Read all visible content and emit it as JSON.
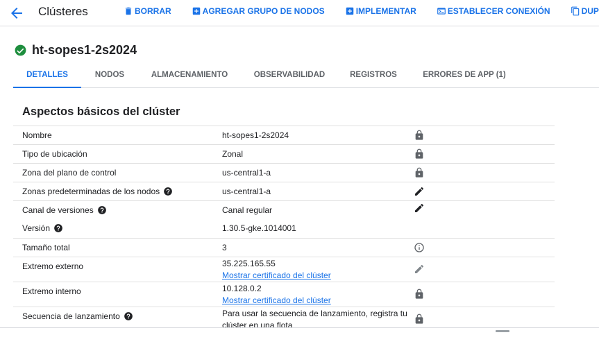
{
  "header": {
    "title": "Clústeres",
    "actions": [
      {
        "label": "BORRAR",
        "icon": "delete-icon"
      },
      {
        "label": "AGREGAR GRUPO DE NODOS",
        "icon": "add-box-icon"
      },
      {
        "label": "IMPLEMENTAR",
        "icon": "add-box-icon"
      },
      {
        "label": "ESTABLECER CONEXIÓN",
        "icon": "terminal-icon"
      },
      {
        "label": "DUPLICAR",
        "icon": "copy-icon"
      }
    ]
  },
  "cluster": {
    "name": "ht-sopes1-2s2024",
    "status_icon": "check-circle-icon",
    "status_color": "#1e8e3e"
  },
  "tabs": [
    {
      "label": "DETALLES",
      "active": true
    },
    {
      "label": "NODOS"
    },
    {
      "label": "ALMACENAMIENTO"
    },
    {
      "label": "OBSERVABILIDAD"
    },
    {
      "label": "REGISTROS"
    },
    {
      "label": "ERRORES DE APP (1)"
    }
  ],
  "section": {
    "title": "Aspectos básicos del clúster",
    "rows": [
      {
        "label": "Nombre",
        "value": "ht-sopes1-2s2024",
        "icon": "lock-icon"
      },
      {
        "label": "Tipo de ubicación",
        "value": "Zonal",
        "icon": "lock-icon"
      },
      {
        "label": "Zona del plano de control",
        "value": "us-central1-a",
        "icon": "lock-icon"
      },
      {
        "label": "Zonas predeterminadas de los nodos",
        "value": "us-central1-a",
        "icon": "edit-icon",
        "help": true
      },
      {
        "label": "Canal de versiones",
        "value": "Canal regular",
        "icon": "edit-icon",
        "help": true
      },
      {
        "label": "Versión",
        "value": "1.30.5-gke.1014001",
        "help": true
      },
      {
        "label": "Tamaño total",
        "value": "3",
        "icon": "info-icon"
      },
      {
        "label": "Extremo externo",
        "value": "35.225.165.55",
        "link": "Mostrar certificado del clúster",
        "icon": "edit-icon-disabled"
      },
      {
        "label": "Extremo interno",
        "value": "10.128.0.2",
        "link": "Mostrar certificado del clúster",
        "icon": "lock-icon"
      },
      {
        "label": "Secuencia de lanzamiento",
        "value": "Para usar la secuencia de lanzamiento, registra tu clúster en una flota",
        "icon": "lock-icon",
        "help": true
      }
    ]
  },
  "colors": {
    "accent": "#1a73e8",
    "text": "#202124",
    "muted": "#5f6368",
    "icon_gray": "#5f6368",
    "divider": "#e0e0e0"
  }
}
